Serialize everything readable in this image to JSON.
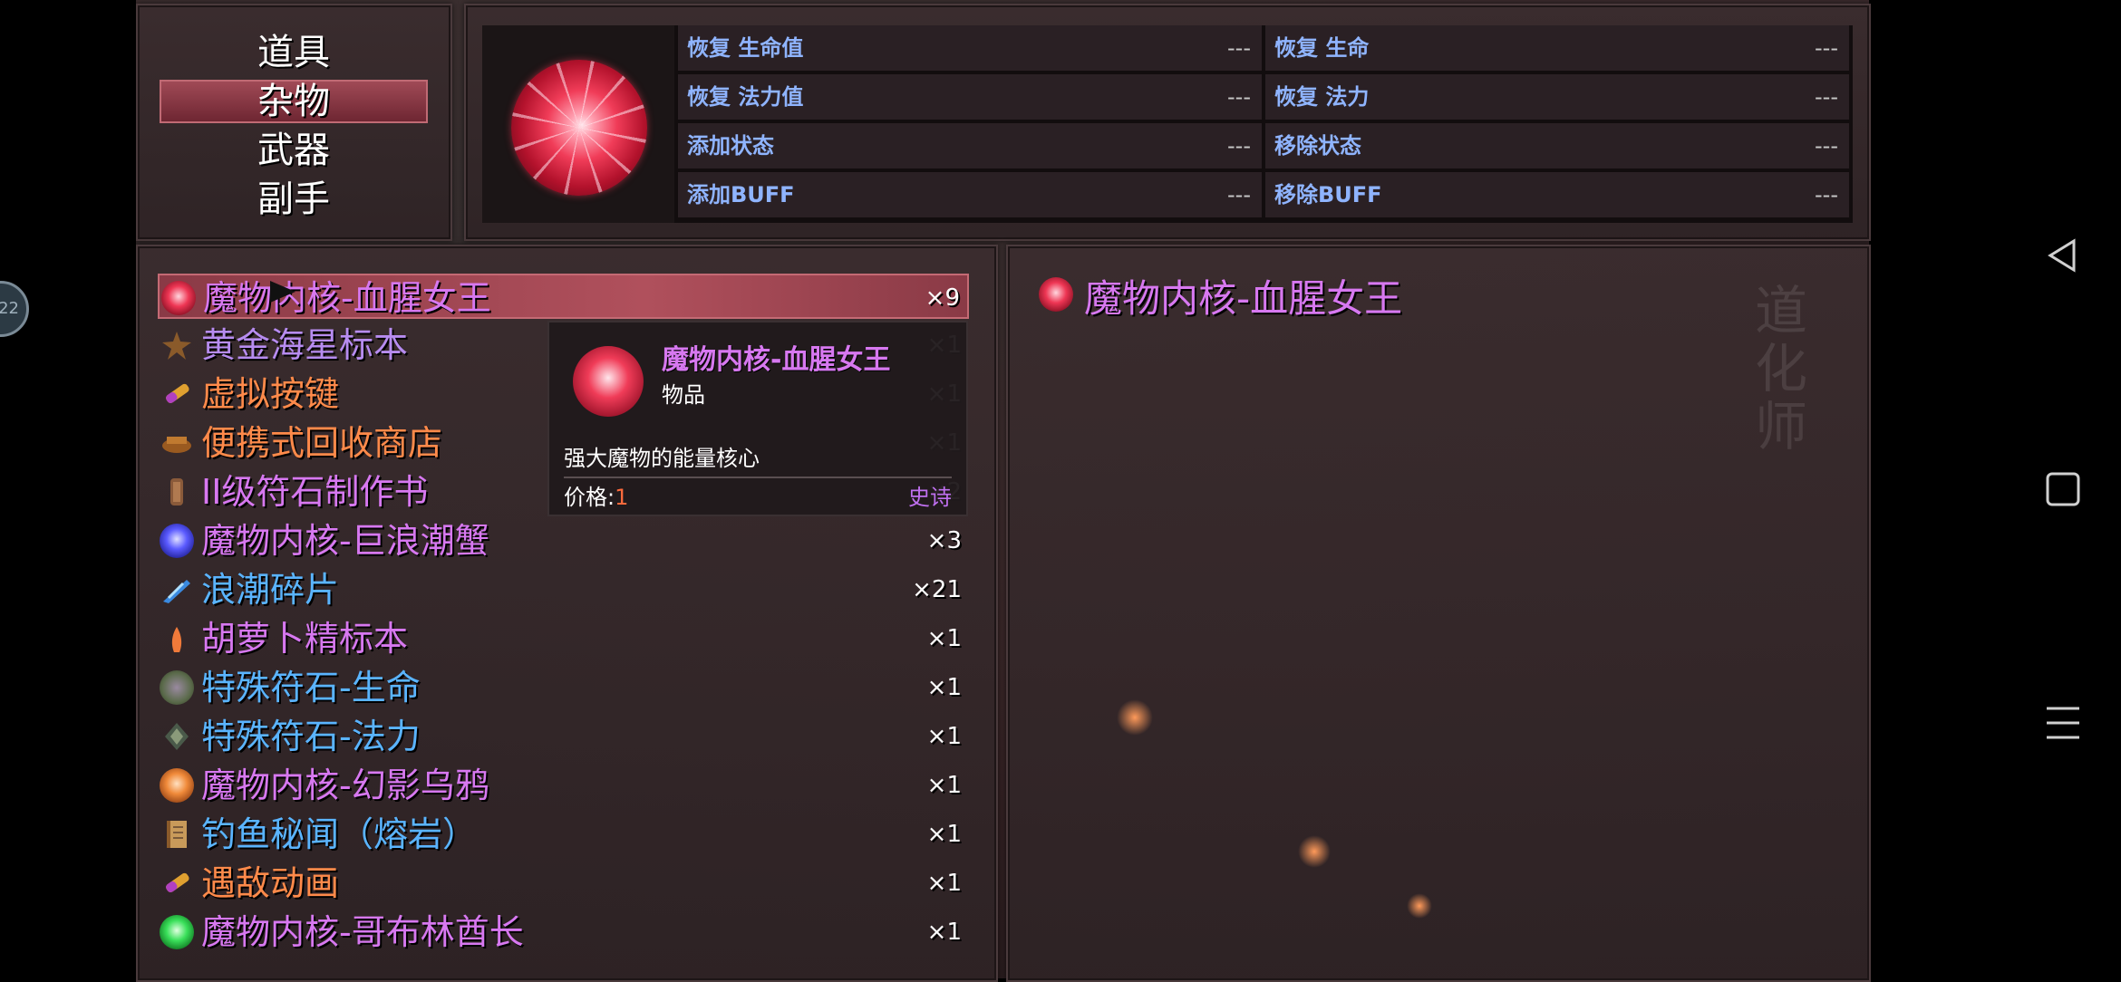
{
  "categories": [
    {
      "label": "道具",
      "selected": false
    },
    {
      "label": "杂物",
      "selected": true
    },
    {
      "label": "武器",
      "selected": false
    },
    {
      "label": "副手",
      "selected": false
    }
  ],
  "stats": [
    {
      "label": "恢复 生命值",
      "value": "---"
    },
    {
      "label": "恢复 生命",
      "value": "---"
    },
    {
      "label": "恢复 法力值",
      "value": "---"
    },
    {
      "label": "恢复 法力",
      "value": "---"
    },
    {
      "label": "添加状态",
      "value": "---"
    },
    {
      "label": "移除状态",
      "value": "---"
    },
    {
      "label": "添加BUFF",
      "value": "---"
    },
    {
      "label": "移除BUFF",
      "value": "---"
    }
  ],
  "items": [
    {
      "name": "魔物内核-血腥女王",
      "count": "×9",
      "color": "#d778f0",
      "icon": "red-core-orb-icon",
      "selected": true
    },
    {
      "name": "黄金海星标本",
      "count": "×1",
      "color": "#b78cf0",
      "icon": "starfish-icon"
    },
    {
      "name": "虚拟按键",
      "count": "×1",
      "color": "#ff8a4a",
      "icon": "virtual-key-icon"
    },
    {
      "name": "便携式回收商店",
      "count": "×1",
      "color": "#ff8a4a",
      "icon": "recycle-shop-icon"
    },
    {
      "name": "II级符石制作书",
      "count": "×2",
      "color": "#d778f0",
      "icon": "rune-book-icon"
    },
    {
      "name": "魔物内核-巨浪潮蟹",
      "count": "×3",
      "color": "#d778f0",
      "icon": "blue-core-orb-icon"
    },
    {
      "name": "浪潮碎片",
      "count": "×21",
      "color": "#5ab4ff",
      "icon": "tide-shard-icon"
    },
    {
      "name": "胡萝卜精标本",
      "count": "×1",
      "color": "#d778f0",
      "icon": "carrot-icon"
    },
    {
      "name": "特殊符石-生命",
      "count": "×1",
      "color": "#5ab4ff",
      "icon": "life-rune-icon"
    },
    {
      "name": "特殊符石-法力",
      "count": "×1",
      "color": "#5ab4ff",
      "icon": "mana-rune-icon"
    },
    {
      "name": "魔物内核-幻影乌鸦",
      "count": "×1",
      "color": "#d778f0",
      "icon": "orange-core-orb-icon"
    },
    {
      "name": "钓鱼秘闻（熔岩）",
      "count": "×1",
      "color": "#5ab4ff",
      "icon": "scroll-icon"
    },
    {
      "name": "遇敌动画",
      "count": "×1",
      "color": "#ff8a4a",
      "icon": "encounter-anim-icon"
    },
    {
      "name": "魔物内核-哥布林酋长",
      "count": "×1",
      "color": "#d778f0",
      "icon": "green-core-orb-icon"
    }
  ],
  "tooltip": {
    "name": "魔物内核-血腥女王",
    "type": "物品",
    "description": "强大魔物的能量核心",
    "price_label": "价格:",
    "price_value": "1",
    "rarity": "史诗"
  },
  "detail": {
    "name": "魔物内核-血腥女王",
    "background_text": "道化师"
  },
  "float_button": {
    "label": "22"
  },
  "colors": {
    "accent": "#b0505c",
    "stat_label": "#8fb4ff",
    "epic": "#d778f0"
  }
}
